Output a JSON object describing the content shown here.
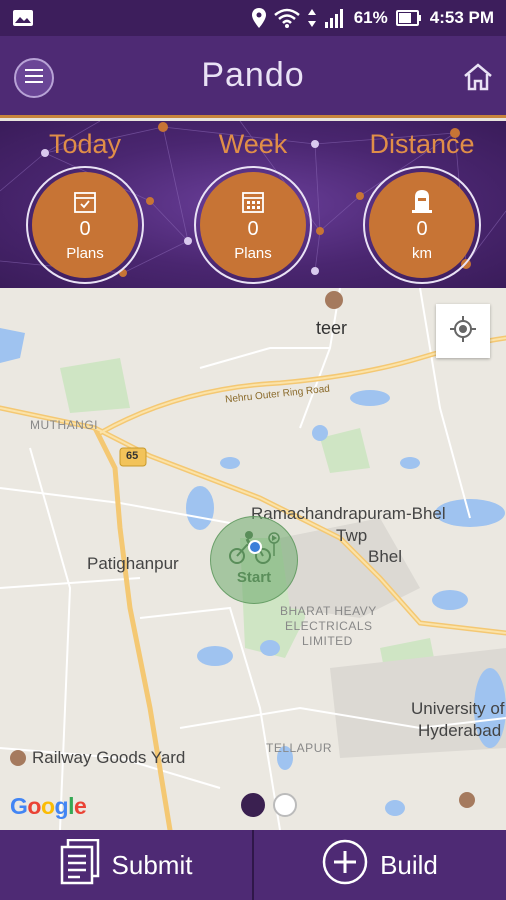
{
  "status_bar": {
    "battery_percent": "61%",
    "time": "4:53 PM",
    "icons": [
      "image-icon",
      "location-icon",
      "wifi-icon",
      "signal-icon",
      "battery-icon"
    ]
  },
  "app_bar": {
    "title": "Pando",
    "icons": [
      "menu-icon",
      "home-icon"
    ]
  },
  "stats": [
    {
      "label": "Today",
      "value": "0",
      "unit": "Plans",
      "icon": "calendar-check-icon"
    },
    {
      "label": "Week",
      "value": "0",
      "unit": "Plans",
      "icon": "calendar-grid-icon"
    },
    {
      "label": "Distance",
      "value": "0",
      "unit": "km",
      "icon": "milestone-icon"
    }
  ],
  "map": {
    "labels": {
      "teer": "teer",
      "ring_road": "Nehru Outer Ring Road",
      "muthangi": "MUTHANGI",
      "highway": "65",
      "ramachandrapuram": "Ramachandrapuram-Bhel",
      "twp": "Twp",
      "bhel": "Bhel",
      "patighanpur": "Patighanpur",
      "bharat1": "BHARAT HEAVY",
      "bharat2": "ELECTRICALS",
      "bharat3": "LIMITED",
      "university1": "University of",
      "university2": "Hyderabad",
      "railway": "Railway Goods Yard",
      "tellapur": "TELLAPUR"
    },
    "marker_label": "Start",
    "attribution": "Google",
    "page_indicator": {
      "count": 2,
      "active": 1
    }
  },
  "bottom_bar": {
    "submit_label": "Submit",
    "build_label": "Build"
  },
  "colors": {
    "primary": "#4e2a74",
    "accent": "#c77435",
    "label": "#e08e48"
  }
}
